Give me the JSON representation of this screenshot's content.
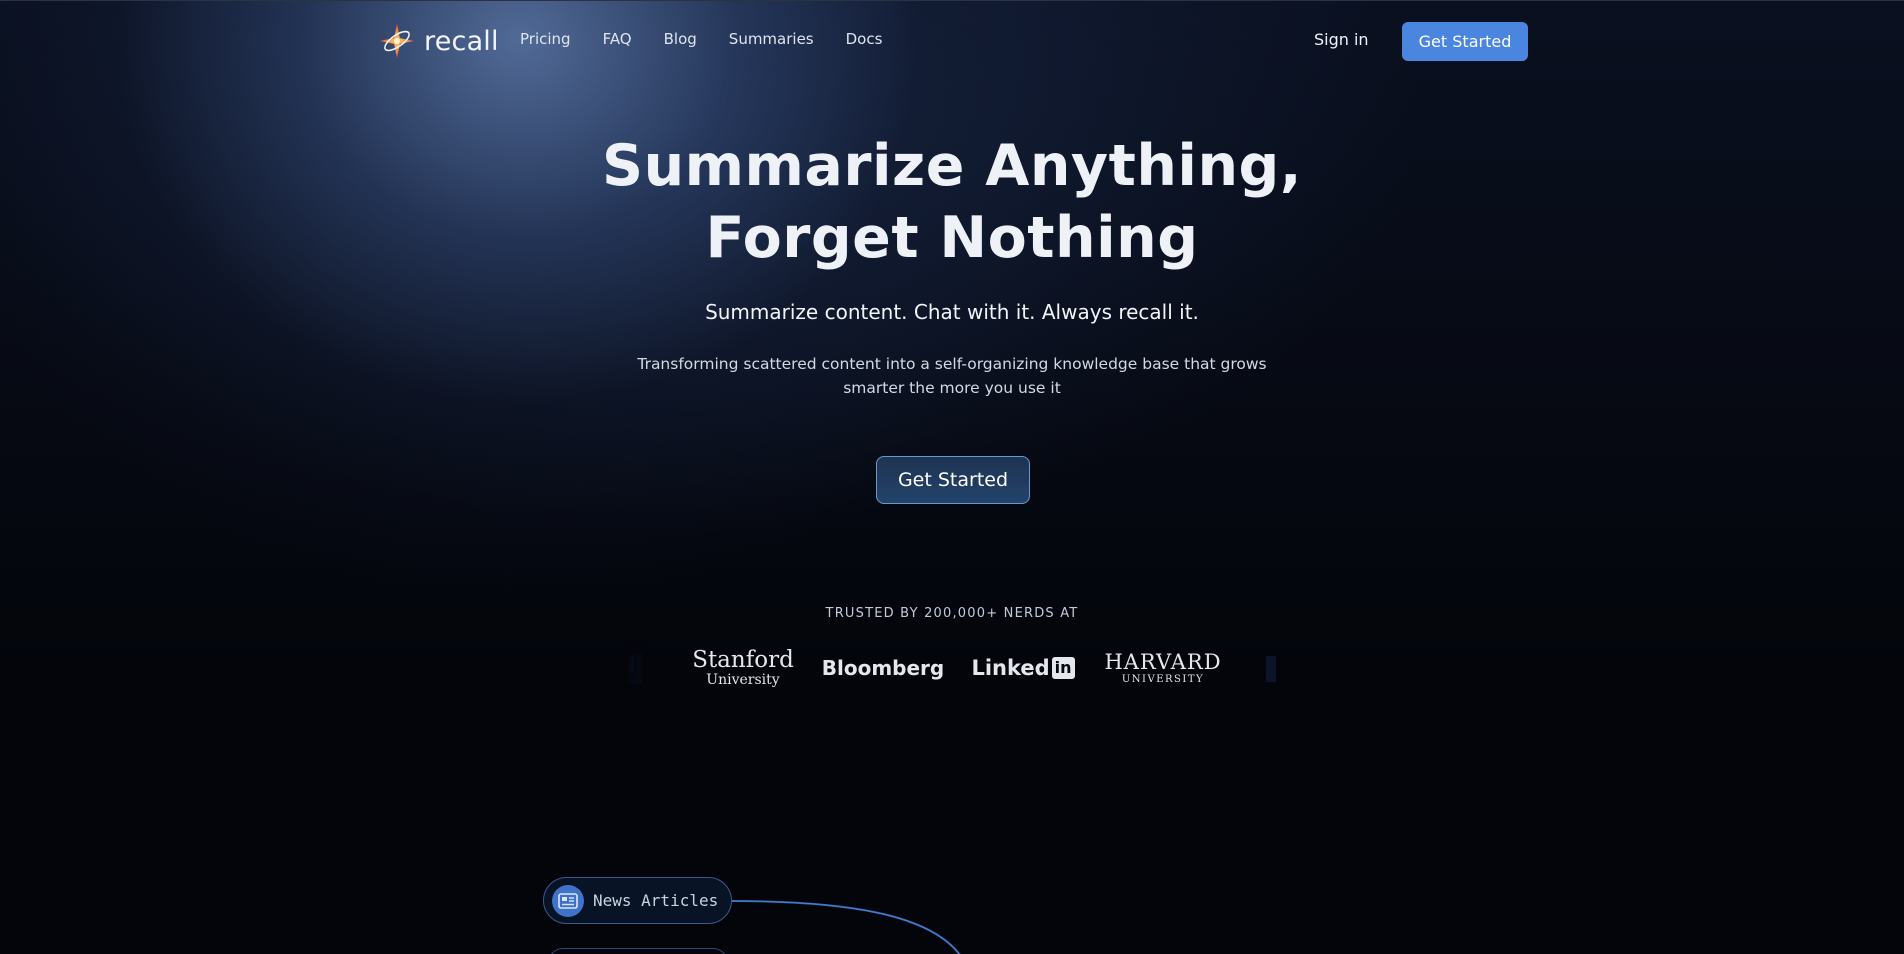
{
  "brand": {
    "name": "recall"
  },
  "nav": {
    "links": [
      "Pricing",
      "FAQ",
      "Blog",
      "Summaries",
      "Docs"
    ],
    "sign_in": "Sign in",
    "cta": "Get Started"
  },
  "hero": {
    "title_line1": "Summarize Anything,",
    "title_line2": "Forget Nothing",
    "subtitle": "Summarize content. Chat with it. Always recall it.",
    "description": "Transforming scattered content into a self-organizing knowledge base that grows smarter the more you use it",
    "cta": "Get Started"
  },
  "trusted": {
    "heading": "TRUSTED BY 200,000+ NERDS AT",
    "logos": {
      "stanford_line1": "Stanford",
      "stanford_line2": "University",
      "bloomberg": "Bloomberg",
      "linkedin_text": "Linked",
      "linkedin_box": "in",
      "harvard_line1": "HARVARD",
      "harvard_line2": "UNIVERSITY"
    }
  },
  "diagram": {
    "source_label": "News Articles",
    "source_icon": "newspaper-icon"
  },
  "colors": {
    "accent": "#4a86e0",
    "background": "#03050b",
    "hero_button": "#23436b"
  }
}
